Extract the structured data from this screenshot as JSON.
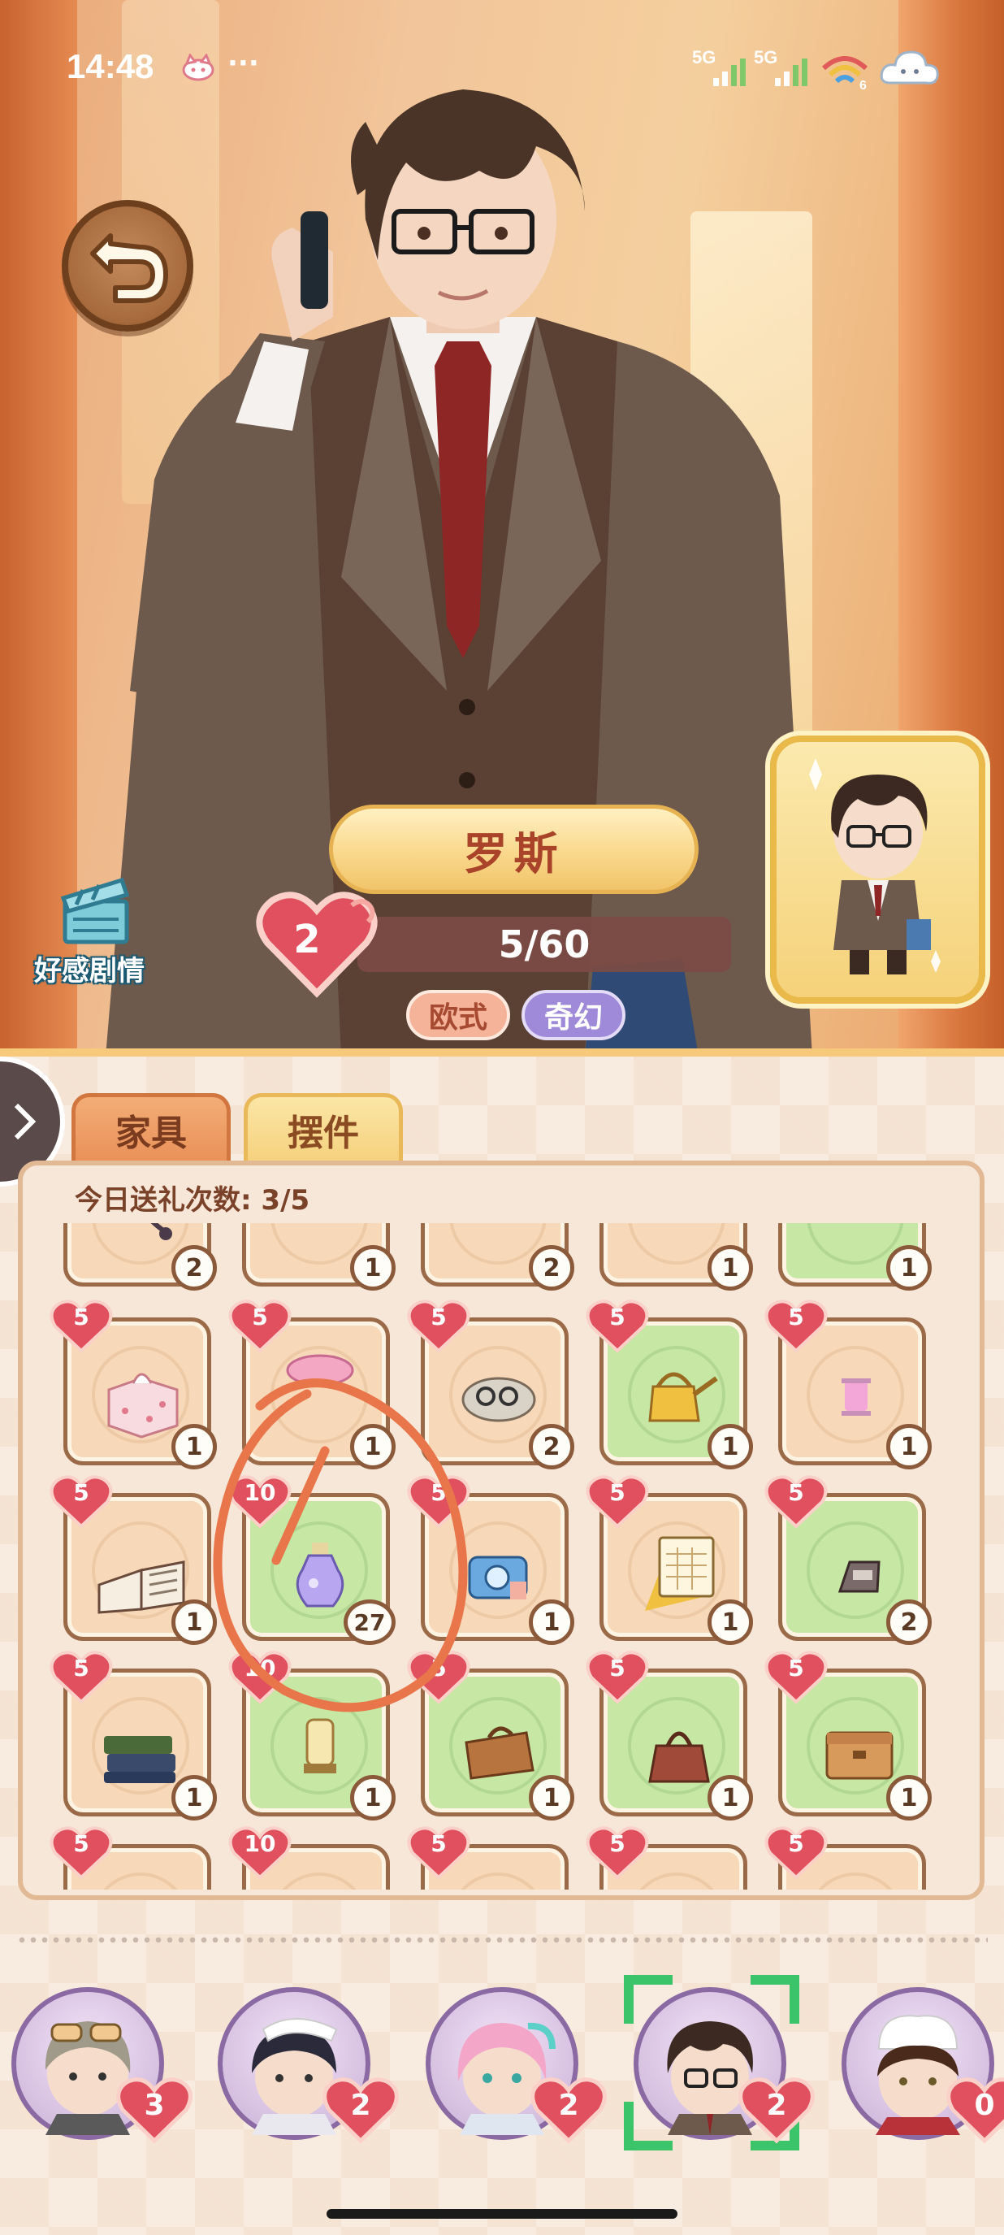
{
  "status_bar": {
    "time": "14:48",
    "more": "···",
    "network1": "5G",
    "network2": "5G",
    "wifi_badge": "6",
    "icons": [
      "cat-icon",
      "signal-icon",
      "signal-icon",
      "wifi-icon",
      "cloud-icon"
    ]
  },
  "character": {
    "name": "罗斯",
    "affection_level": "2",
    "progress_text": "5/60",
    "progress": {
      "current": 5,
      "max": 60
    },
    "tags": [
      "欧式",
      "奇幻"
    ]
  },
  "story_button": {
    "label": "好感剧情",
    "icon": "clapperboard-icon"
  },
  "tabs": [
    {
      "label": "家具",
      "selected": true
    },
    {
      "label": "摆件",
      "selected": false
    }
  ],
  "gift_count_text": "今日送礼次数: 3/5",
  "inventory_rows": [
    [
      {
        "item": "beads-icon",
        "fav": "",
        "count": "2",
        "green": false
      },
      {
        "item": "drink-box-icon",
        "fav": "",
        "count": "1",
        "green": false
      },
      {
        "item": "trophy-icon",
        "fav": "",
        "count": "2",
        "green": false
      },
      {
        "item": "pillow-icon",
        "fav": "",
        "count": "1",
        "green": false
      },
      {
        "item": "red-book-icon",
        "fav": "",
        "count": "1",
        "green": true
      }
    ],
    [
      {
        "item": "tissue-box-icon",
        "fav": "5",
        "count": "1",
        "green": false
      },
      {
        "item": "pink-plate-icon",
        "fav": "5",
        "count": "1",
        "green": false
      },
      {
        "item": "glasses-tray-icon",
        "fav": "5",
        "count": "2",
        "green": false
      },
      {
        "item": "watering-can-icon",
        "fav": "5",
        "count": "1",
        "green": true
      },
      {
        "item": "thread-spool-icon",
        "fav": "5",
        "count": "1",
        "green": false
      }
    ],
    [
      {
        "item": "open-book-icon",
        "fav": "5",
        "count": "1",
        "green": false
      },
      {
        "item": "potion-bottle-icon",
        "fav": "10",
        "count": "27",
        "green": true
      },
      {
        "item": "camera-icon",
        "fav": "5",
        "count": "1",
        "green": false
      },
      {
        "item": "calendar-icon",
        "fav": "5",
        "count": "1",
        "green": false
      },
      {
        "item": "name-plate-icon",
        "fav": "5",
        "count": "2",
        "green": true
      }
    ],
    [
      {
        "item": "green-books-icon",
        "fav": "5",
        "count": "1",
        "green": false
      },
      {
        "item": "lantern-icon",
        "fav": "10",
        "count": "1",
        "green": true
      },
      {
        "item": "brown-bag-icon",
        "fav": "5",
        "count": "1",
        "green": true
      },
      {
        "item": "handbag-icon",
        "fav": "5",
        "count": "1",
        "green": true
      },
      {
        "item": "wooden-box-icon",
        "fav": "5",
        "count": "1",
        "green": true
      }
    ],
    [
      {
        "item": "",
        "fav": "5",
        "count": "",
        "green": false
      },
      {
        "item": "",
        "fav": "10",
        "count": "",
        "green": false
      },
      {
        "item": "",
        "fav": "5",
        "count": "",
        "green": false
      },
      {
        "item": "",
        "fav": "5",
        "count": "",
        "green": false
      },
      {
        "item": "",
        "fav": "5",
        "count": "",
        "green": false
      }
    ]
  ],
  "characters": [
    {
      "avatar": "goggles-character",
      "affection": "3",
      "selected": false
    },
    {
      "avatar": "nurse-character",
      "affection": "2",
      "selected": false
    },
    {
      "avatar": "pink-hair-character",
      "affection": "2",
      "selected": false
    },
    {
      "avatar": "glasses-man-character",
      "affection": "2",
      "selected": true
    },
    {
      "avatar": "chef-character",
      "affection": "0",
      "selected": false
    }
  ],
  "colors": {
    "heart": "#e0505e",
    "annotation": "#e8764a",
    "tab_active": "#e99058",
    "tab_inactive": "#f5d17d"
  }
}
